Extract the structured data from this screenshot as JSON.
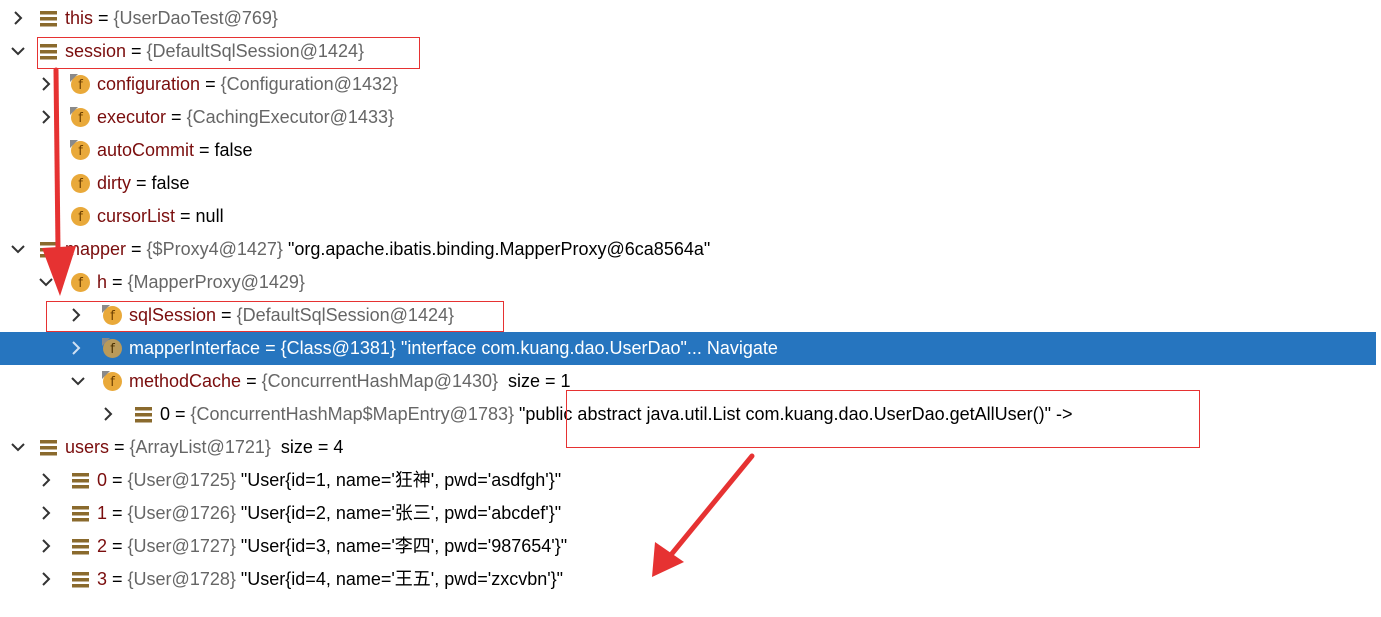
{
  "rows": [
    {
      "name": "this",
      "eq": " = ",
      "type": "{UserDaoTest@769}",
      "extra": ""
    },
    {
      "name": "session",
      "eq": " = ",
      "type": "{DefaultSqlSession@1424}",
      "extra": ""
    },
    {
      "name": "configuration",
      "eq": " = ",
      "type": "{Configuration@1432}",
      "extra": ""
    },
    {
      "name": "executor",
      "eq": " = ",
      "type": "{CachingExecutor@1433}",
      "extra": ""
    },
    {
      "name": "autoCommit",
      "eq": " = ",
      "type": "",
      "extra": "false"
    },
    {
      "name": "dirty",
      "eq": " = ",
      "type": "",
      "extra": "false"
    },
    {
      "name": "cursorList",
      "eq": " = ",
      "type": "",
      "extra": "null"
    },
    {
      "name": "mapper",
      "eq": " = ",
      "type": "{$Proxy4@1427}",
      "extra": "\"org.apache.ibatis.binding.MapperProxy@6ca8564a\""
    },
    {
      "name": "h",
      "eq": " = ",
      "type": "{MapperProxy@1429}",
      "extra": ""
    },
    {
      "name": "sqlSession",
      "eq": " = ",
      "type": "{DefaultSqlSession@1424}",
      "extra": ""
    },
    {
      "name": "mapperInterface",
      "eq": " = ",
      "type": "{Class@1381}",
      "extra": "\"interface com.kuang.dao.UserDao\"... Navigate"
    },
    {
      "name": "methodCache",
      "eq": " = ",
      "type": "{ConcurrentHashMap@1430}",
      "extra": "size = 1"
    },
    {
      "name": "0",
      "eq": " = ",
      "type": "{ConcurrentHashMap$MapEntry@1783}",
      "extra": "\"public abstract java.util.List com.kuang.dao.UserDao.getAllUser()\" ->"
    },
    {
      "name": "users",
      "eq": " = ",
      "type": "{ArrayList@1721}",
      "extra": "size = 4"
    },
    {
      "name": "0",
      "eq": " = ",
      "type": "{User@1725}",
      "extra": "\"User{id=1, name='狂神', pwd='asdfgh'}\""
    },
    {
      "name": "1",
      "eq": " = ",
      "type": "{User@1726}",
      "extra": "\"User{id=2, name='张三', pwd='abcdef'}\""
    },
    {
      "name": "2",
      "eq": " = ",
      "type": "{User@1727}",
      "extra": "\"User{id=3, name='李四', pwd='987654'}\""
    },
    {
      "name": "3",
      "eq": " = ",
      "type": "{User@1728}",
      "extra": "\"User{id=4, name='王五', pwd='zxcvbn'}\""
    }
  ],
  "colors": {
    "selection": "#2675bf",
    "field_name": "#7a0d0d",
    "type_text": "#666666",
    "annotation": "#e63232",
    "field_icon": "#e9a93a"
  }
}
